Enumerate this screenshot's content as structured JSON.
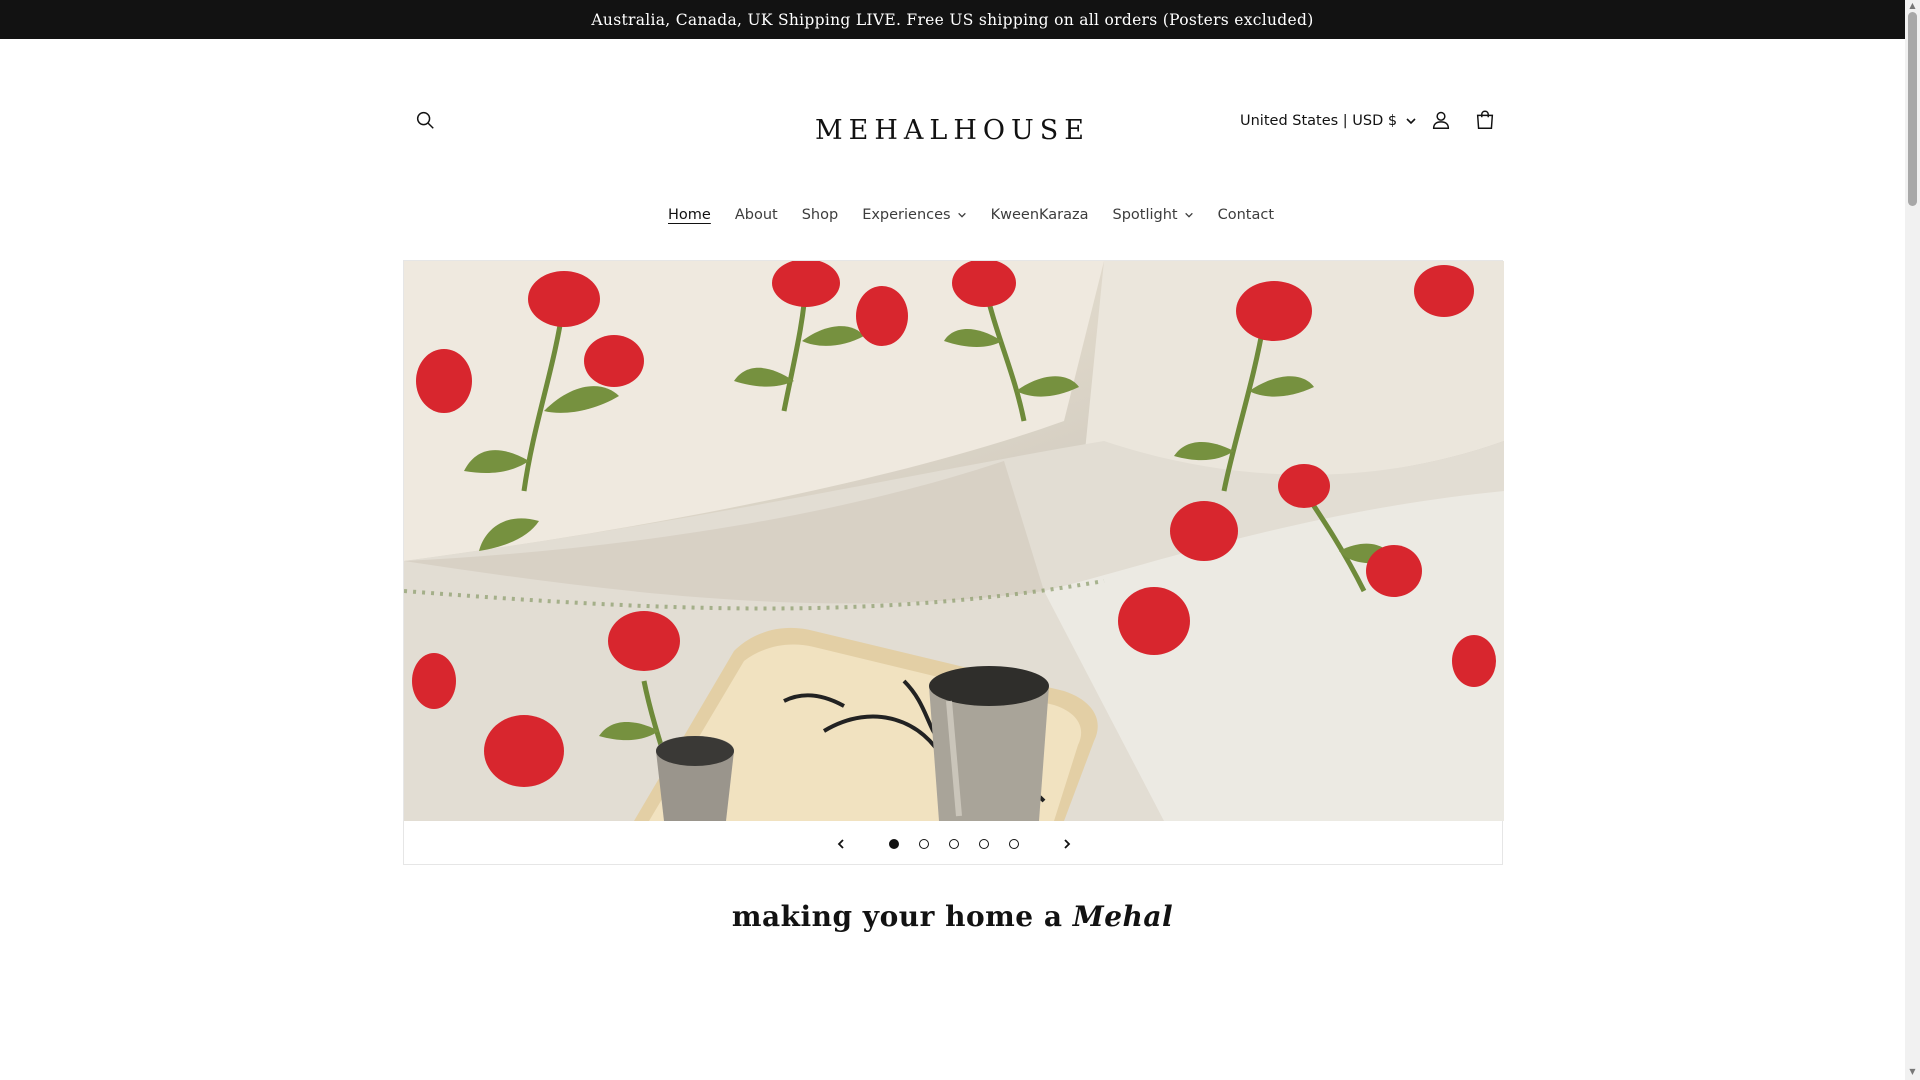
{
  "announcement": {
    "text": "Australia, Canada, UK Shipping LIVE. Free US shipping on all orders (Posters excluded)"
  },
  "header": {
    "logo_left": "MEHAL",
    "logo_right": "HOUSE",
    "country_selector": "United States | USD $",
    "icons": {
      "search": "search-icon",
      "account": "account-icon",
      "cart": "cart-icon"
    }
  },
  "nav": {
    "items": [
      {
        "label": "Home",
        "active": true,
        "dropdown": false
      },
      {
        "label": "About",
        "active": false,
        "dropdown": false
      },
      {
        "label": "Shop",
        "active": false,
        "dropdown": false
      },
      {
        "label": "Experiences",
        "active": false,
        "dropdown": true
      },
      {
        "label": "KweenKaraza",
        "active": false,
        "dropdown": false
      },
      {
        "label": "Spotlight",
        "active": false,
        "dropdown": true
      },
      {
        "label": "Contact",
        "active": false,
        "dropdown": false
      }
    ]
  },
  "slideshow": {
    "slide_count": 5,
    "active_slide": 1
  },
  "tagline": {
    "text": "making your home a ",
    "emphasis": "Mehal"
  },
  "colors": {
    "announcement_bg": "#121212",
    "text": "#121212",
    "flower_red": "#d8262e",
    "leaf_green": "#6e8a3a"
  }
}
